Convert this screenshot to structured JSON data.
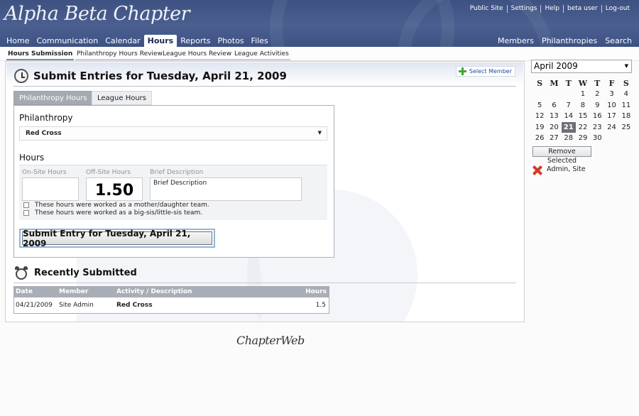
{
  "header": {
    "logo_text": "Alpha Beta Chapter",
    "top_links": [
      "Public Site",
      "Settings",
      "Help",
      "beta user",
      "Log-out"
    ],
    "nav_tabs": [
      "Home",
      "Communication",
      "Calendar",
      "Hours",
      "Reports",
      "Photos",
      "Files"
    ],
    "active_tab": "Hours",
    "right_nav": [
      "Members",
      "Philanthropies",
      "Search"
    ]
  },
  "subnav": {
    "items": [
      "Hours Submission",
      "Philanthropy Hours Review",
      "League Hours Review",
      "League Activities"
    ],
    "active": "Hours Submission"
  },
  "main": {
    "title": "Submit Entries for Tuesday, April 21, 2009",
    "select_member_label": "Select Member",
    "form_tabs": [
      "Philanthropy Hours",
      "League Hours"
    ],
    "philanthropy_label": "Philanthropy",
    "philanthropy_value": "Red Cross",
    "hours_label": "Hours",
    "onsite_label": "On-Site Hours",
    "offsite_label": "Off-Site Hours",
    "description_label": "Brief Description",
    "onsite_value": "",
    "offsite_value": "1.50",
    "description_value": "Brief Description",
    "checkbox_mother_daughter": "These hours were worked as a mother/daughter team.",
    "checkbox_big_little": "These hours were worked as a big-sis/little-sis team.",
    "submit_label": "Submit Entry for Tuesday, April 21, 2009"
  },
  "recent": {
    "title": "Recently Submitted",
    "columns": [
      "Date",
      "Member",
      "Activity / Description",
      "Hours"
    ],
    "rows": [
      {
        "date": "04/21/2009",
        "member": "Site Admin",
        "activity": "Red Cross",
        "hours": "1.5"
      }
    ]
  },
  "footer": {
    "brand": "ChapterWeb"
  },
  "sidebar": {
    "month_select": "April 2009",
    "weekdays": [
      "S",
      "M",
      "T",
      "W",
      "T",
      "F",
      "S"
    ],
    "weeks": [
      [
        "",
        "",
        "",
        "1",
        "2",
        "3",
        "4"
      ],
      [
        "5",
        "6",
        "7",
        "8",
        "9",
        "10",
        "11"
      ],
      [
        "12",
        "13",
        "14",
        "15",
        "16",
        "17",
        "18"
      ],
      [
        "19",
        "20",
        "21",
        "22",
        "23",
        "24",
        "25"
      ],
      [
        "26",
        "27",
        "28",
        "29",
        "30",
        "",
        ""
      ]
    ],
    "selected_day": "21",
    "remove_label": "Remove Selected",
    "selected_members": [
      "Admin, Site"
    ]
  },
  "colors": {
    "header": "#44588a",
    "accent_blue": "#1c4b9a",
    "remove_red": "#d23a2a",
    "selected_day_bg": "#6c6f77"
  }
}
